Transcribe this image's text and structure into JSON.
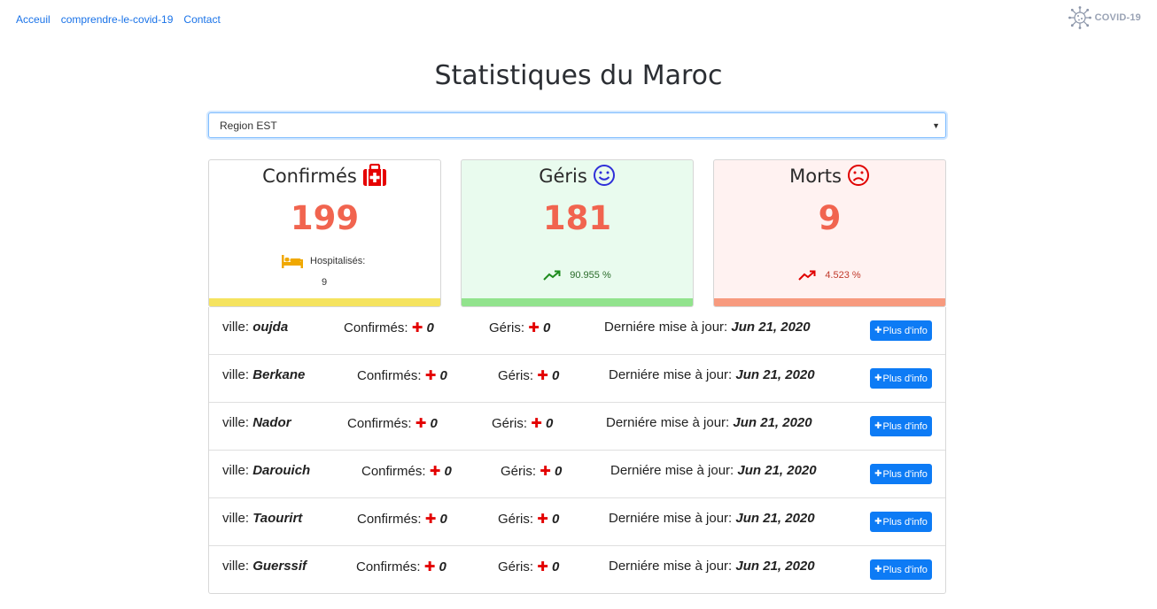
{
  "nav": {
    "items": [
      "Acceuil",
      "comprendre-le-covid-19",
      "Contact"
    ]
  },
  "logo": {
    "text": "COVID-19",
    "icon": "virus-icon"
  },
  "page": {
    "title": "Statistiques du Maroc"
  },
  "region_select": {
    "value": "Region EST"
  },
  "stats": {
    "confirmes": {
      "label": "Confirmés",
      "value": "199",
      "icon": "medkit-icon",
      "hospital_label": "Hospitalisés:",
      "hospital_value": "9"
    },
    "geris": {
      "label": "Géris",
      "value": "181",
      "icon": "smile-icon",
      "trend": "90.955 %"
    },
    "morts": {
      "label": "Morts",
      "value": "9",
      "icon": "frown-icon",
      "trend": "4.523 %"
    }
  },
  "colors": {
    "number": "#f1644f",
    "confirmes_bar": "#f5e35f",
    "geris_bar": "#92e38d",
    "morts_bar": "#f79a7e",
    "button": "#0d7bf5"
  },
  "labels": {
    "ville": "ville:",
    "confirmes": "Confirmés:",
    "geris": "Géris:",
    "updated": "Derniére mise à jour:",
    "more_info": "Plus d'info"
  },
  "cities": [
    {
      "name": "oujda",
      "confirmes": "0",
      "geris": "0",
      "date": "Jun 21, 2020"
    },
    {
      "name": "Berkane",
      "confirmes": "0",
      "geris": "0",
      "date": "Jun 21, 2020"
    },
    {
      "name": "Nador",
      "confirmes": "0",
      "geris": "0",
      "date": "Jun 21, 2020"
    },
    {
      "name": "Darouich",
      "confirmes": "0",
      "geris": "0",
      "date": "Jun 21, 2020"
    },
    {
      "name": "Taourirt",
      "confirmes": "0",
      "geris": "0",
      "date": "Jun 21, 2020"
    },
    {
      "name": "Guerssif",
      "confirmes": "0",
      "geris": "0",
      "date": "Jun 21, 2020"
    }
  ]
}
